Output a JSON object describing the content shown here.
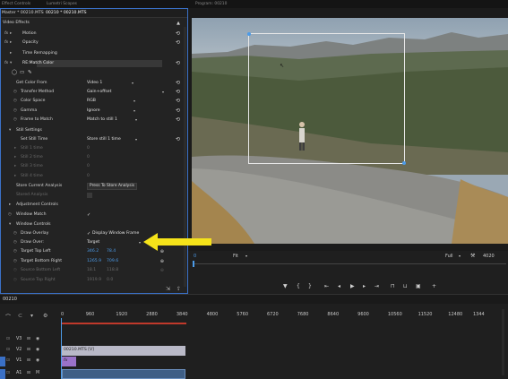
{
  "top_tabs": [
    "Effect Controls",
    "Lumetri Scopes",
    "Program: 00210"
  ],
  "effect_controls": {
    "master_tab": "Master * 00210.MTS",
    "clip_tab": "00210 * 00210.MTS",
    "section_title": "Video Effects",
    "motion": "Motion",
    "opacity": "Opacity",
    "time_remapping": "Time Remapping",
    "effect_name": "RE:Match Color",
    "get_color_from": {
      "label": "Get Color From",
      "value": "Video 1"
    },
    "transfer_method": {
      "label": "Transfer Method",
      "value": "Gain+offset"
    },
    "color_space": {
      "label": "Color Space",
      "value": "RGB"
    },
    "gamma": {
      "label": "Gamma",
      "value": "Ignore"
    },
    "frame_to_match": {
      "label": "Frame to Match",
      "value": "Match to still 1"
    },
    "still_settings": "Still Settings",
    "set_still_time": {
      "label": "Set Still Time",
      "value": "Store still 1 time"
    },
    "still_times": [
      {
        "label": "Still 1 time",
        "value": "0"
      },
      {
        "label": "Still 2 time",
        "value": "0"
      },
      {
        "label": "Still 3 time",
        "value": "0"
      },
      {
        "label": "Still 4 time",
        "value": "0"
      }
    ],
    "store_current_analysis": {
      "label": "Store Current Analysis",
      "button": "Press To Store Analysis"
    },
    "stored_analysis": "Stored Analysis",
    "adjustment_controls": "Adjustment Controls",
    "window_match": {
      "label": "Window Match",
      "check": "✓"
    },
    "window_controls": "Window Controls",
    "draw_overlay": {
      "label": "Draw Overlay",
      "check": "✓",
      "value": "Display Window Frame"
    },
    "draw_over": {
      "label": "Draw Over:",
      "value": "Target"
    },
    "target_top_left": {
      "label": "Target Top Left",
      "x": "346.2",
      "y": "78.4"
    },
    "target_bottom_right": {
      "label": "Target Bottom Right",
      "x": "1265.9",
      "y": "709.6"
    },
    "source_bottom_left": {
      "label": "Source Bottom Left",
      "x": "18.1",
      "y": "118.8"
    },
    "source_top_right": {
      "label": "Source Top Right",
      "x": "1919.9",
      "y": "0.0"
    }
  },
  "program_monitor": {
    "timecode": "0",
    "fit": "Fit",
    "full": "Full",
    "end_timecode": "4020"
  },
  "timeline": {
    "sequence_tab": "00210",
    "ruler_labels": [
      "0",
      "960",
      "1920",
      "2880",
      "3840",
      "4800",
      "5760",
      "6720",
      "7680",
      "8640",
      "9600",
      "10560",
      "11520",
      "12480",
      "1344"
    ],
    "tracks": [
      "V3",
      "V2",
      "V1",
      "A1"
    ],
    "clip_label": "00210.MTS [V]",
    "clip_v1_label": "fx"
  },
  "colors": {
    "accent": "#3a70c6",
    "clip_v2": "#b9b9c7",
    "clip_v1": "#9a72c9",
    "audio_clip": "#3f5f86",
    "arrow": "#f5e31a",
    "playhead": "#4c9be8"
  }
}
